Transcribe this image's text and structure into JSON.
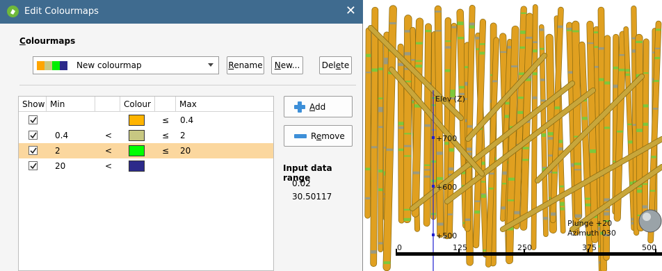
{
  "dialog": {
    "title": "Edit Colourmaps",
    "section_label": "Colourmaps",
    "colourmap_select": {
      "value": "New colourmap",
      "swatch_colors": [
        "#ffa500",
        "#c8c882",
        "#00ee00",
        "#2c2a8a"
      ]
    },
    "buttons": {
      "rename": "Rename",
      "new": "New...",
      "delete": "Delete",
      "add": "Add",
      "remove": "Remove"
    },
    "table": {
      "headers": [
        "Show",
        "Min",
        "",
        "Colour",
        "",
        "Max"
      ],
      "rows": [
        {
          "show": true,
          "min": "",
          "min_op": "",
          "colour": "#ffb400",
          "max_op": "≤",
          "max": "0.4",
          "selected": false
        },
        {
          "show": true,
          "min": "0.4",
          "min_op": "<",
          "colour": "#c8c882",
          "max_op": "≤",
          "max": "2",
          "selected": false
        },
        {
          "show": true,
          "min": "2",
          "min_op": "<",
          "colour": "#00ff00",
          "max_op": "≤",
          "max": "20",
          "selected": true
        },
        {
          "show": true,
          "min": "20",
          "min_op": "<",
          "colour": "#2c2a8a",
          "max_op": "",
          "max": "",
          "selected": false
        }
      ]
    },
    "input_range": {
      "label": "Input data range",
      "min": "0.02",
      "max": "30.50117"
    }
  },
  "scene": {
    "axis_label": "Elev (Z)",
    "elev_ticks": [
      "+700",
      "+600",
      "+500"
    ],
    "orientation": [
      "Plunge +20",
      "Azimuth 030"
    ],
    "scale_ticks": [
      "0",
      "125",
      "250",
      "375",
      "500"
    ],
    "colors": {
      "rod": "#e0a020",
      "rod_band": "#7dc83c",
      "rod_band_grey": "#9a9a80",
      "axis": "#2020d0"
    }
  }
}
